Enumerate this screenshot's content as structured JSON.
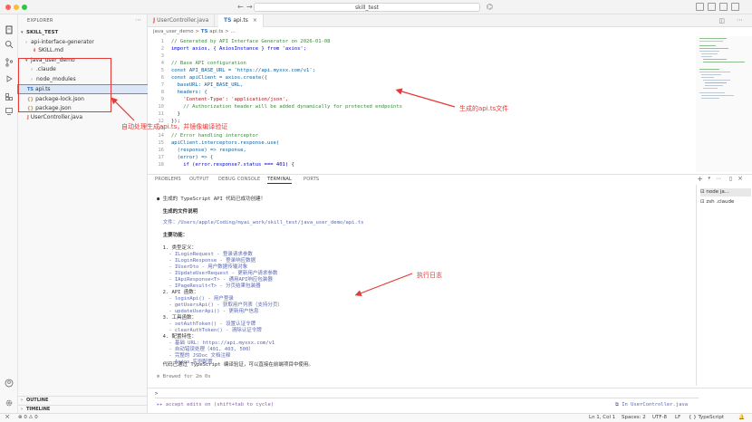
{
  "titlebar": {
    "search_text": "skill_test"
  },
  "sidebar": {
    "header": "EXPLORER",
    "root": "SKILL_TEST",
    "items": [
      {
        "label": "api-interface-generator",
        "icon": "chevron-right"
      },
      {
        "label": "SKILL.md",
        "icon": "markdown-icon"
      },
      {
        "label": "java_user_demo",
        "icon": "chevron-down"
      },
      {
        "label": ".claude",
        "icon": "chevron-right"
      },
      {
        "label": "node_modules",
        "icon": "chevron-right"
      },
      {
        "label": "api.ts",
        "icon": "ts-icon",
        "badge": "TS"
      },
      {
        "label": "package-lock.json",
        "icon": "json-icon",
        "badge": "{}"
      },
      {
        "label": "package.json",
        "icon": "json-icon",
        "badge": "{}"
      },
      {
        "label": "UserController.java",
        "icon": "java-icon",
        "badge": "J"
      }
    ],
    "outline": "OUTLINE",
    "timeline": "TIMELINE"
  },
  "editor": {
    "tabs": [
      {
        "label": "UserController.java",
        "badge": "J"
      },
      {
        "label": "api.ts",
        "badge": "TS"
      }
    ],
    "breadcrumb": [
      "java_user_demo",
      ">",
      "TS",
      "api.ts",
      ">",
      "..."
    ],
    "line_numbers": [
      "1",
      "2",
      "3",
      "4",
      "5",
      "6",
      "7",
      "8",
      "9",
      "10",
      "11",
      "12",
      "13",
      "14",
      "15",
      "16",
      "17",
      "18"
    ],
    "code": [
      "// Generated by API Interface Generator on 2026-01-08",
      "import axios, { AxiosInstance } from 'axios';",
      "",
      "// Base API configuration",
      "const API_BASE_URL = 'https://api.myxxx.com/v1';",
      "const apiClient = axios.create({",
      "  baseURL: API_BASE_URL,",
      "  headers: {",
      "    'Content-Type': 'application/json',",
      "    // Authorization header will be added dynamically for protected endpoints",
      "  }",
      "});",
      "",
      "// Error handling interceptor",
      "apiClient.interceptors.response.use(",
      "  (response) => response,",
      "  (error) => {",
      "    if (error.response?.status === 401) {"
    ]
  },
  "panel": {
    "tabs": [
      "PROBLEMS",
      "OUTPUT",
      "DEBUG CONSOLE",
      "TERMINAL",
      "PORTS"
    ],
    "terminal_sessions": [
      {
        "label": "node ja..."
      },
      {
        "label": "zsh .claude"
      }
    ],
    "terminal_lines": [
      "● 生成的 TypeScript API 代码已成功创建！",
      "",
      "  生成的文件说明",
      "",
      "  文件：/Users/apple/Coding/myai_work/skill_test/java_user_demo/api.ts",
      "",
      "  主要功能：",
      "",
      "  1. 类型定义：",
      "    - ILoginRequest - 登录请求参数",
      "    - ILoginResponse - 登录响应数据",
      "    - IUserDto - 用户数据传输对象",
      "    - IUpdateUserRequest - 更新用户请求参数",
      "    - IApiResponse<T> - 通用API响应包装器",
      "    - IPageResult<T> - 分页结果包装器",
      "  2. API 函数：",
      "    - loginApi() - 用户登录",
      "    - getUsersApi() - 获取用户列表（支持分页）",
      "    - updateUserApi() - 更新用户信息",
      "  3. 工具函数：",
      "    - setAuthToken() - 设置认证令牌",
      "    - clearAuthToken() - 清除认证令牌",
      "  4. 配置特性：",
      "    - 基础 URL: https://api.myxxx.com/v1",
      "    - 自动错误处理（401, 403, 500）",
      "    - 完整的 JSDoc 文档注释",
      "    - Axios 实例配置",
      "",
      "  代码已通过 TypeScript 编译验证，可以直接在前端项目中使用。",
      "",
      "✻ Brewed for 2m 0s"
    ],
    "prompt_symbol": ">",
    "prompt_hint": "▸▸ accept edits on (shift+tab to cycle)",
    "prompt_context": "⧉ In UserController.java"
  },
  "statusbar": {
    "items": [
      "Ln 1, Col 1",
      "Spaces: 2",
      "UTF-8",
      "LF",
      "{ } TypeScript"
    ]
  },
  "annotations": {
    "auto_text": "自动处理生成api.ts，并镜像编译验证",
    "file_text": "生成的api.ts文件",
    "log_text": "执行日志"
  },
  "colors": {
    "annotation": "#e53935",
    "accent": "#0078d4"
  }
}
